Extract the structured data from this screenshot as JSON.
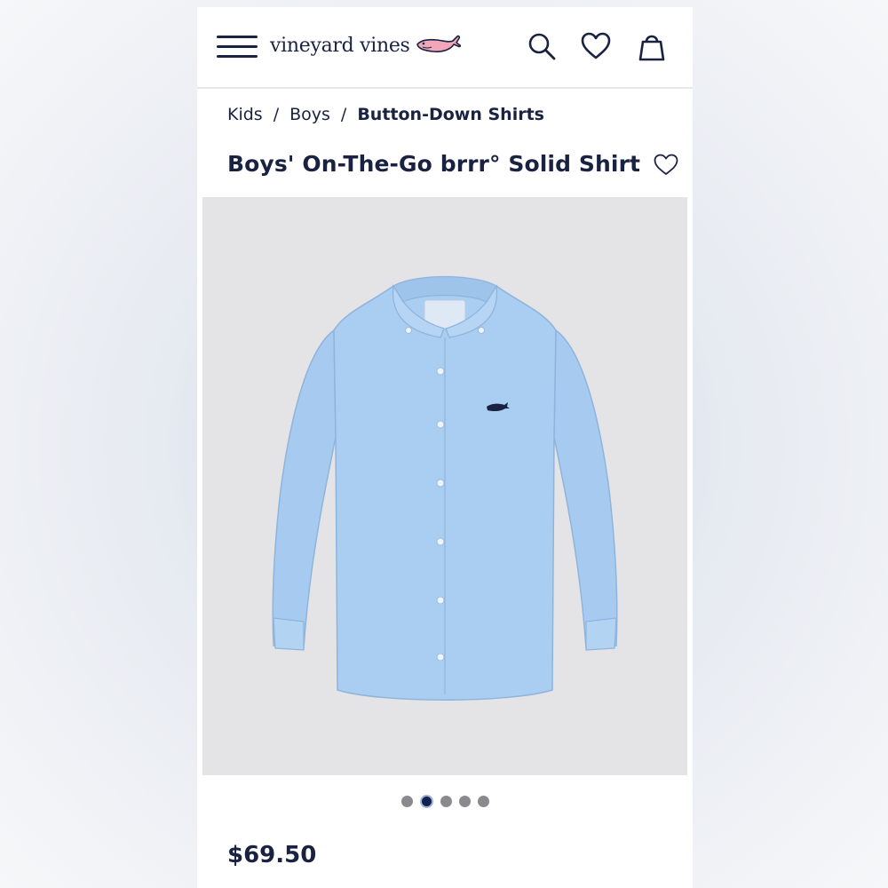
{
  "header": {
    "logo_text": "vineyard vines",
    "icons": [
      "menu-icon",
      "search-icon",
      "heart-icon",
      "shopping-bag-icon"
    ]
  },
  "breadcrumb": {
    "items": [
      "Kids",
      "Boys",
      "Button-Down Shirts"
    ],
    "separator": "/"
  },
  "product": {
    "title": "Boys' On-The-Go brrr° Solid Shirt",
    "price": "$69.50",
    "shirt_color": "#a9cdf2",
    "image_bg": "#e4e4e6"
  },
  "carousel": {
    "dot_count": 5,
    "active_index": 1
  },
  "colors": {
    "navy": "#1a2242",
    "whale_pink": "#f2a6b9"
  }
}
